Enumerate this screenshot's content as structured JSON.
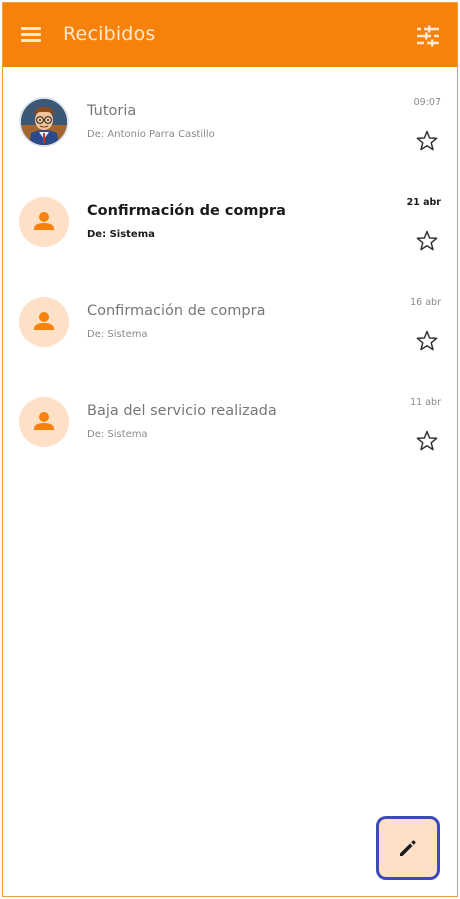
{
  "appbar": {
    "title": "Recibidos",
    "menu_icon": "menu-icon",
    "filter_icon": "tune-icon",
    "color": "#f6820c"
  },
  "messages": [
    {
      "subject": "Tutoria",
      "sender": "De: Antonio Parra Castillo",
      "date": "09:07",
      "unread": false,
      "avatar": "cartoon-teacher-avatar"
    },
    {
      "subject": "Confirmación de compra",
      "sender": "De: Sistema",
      "date": "21 abr",
      "unread": true,
      "avatar": "person-icon"
    },
    {
      "subject": "Confirmación de compra",
      "sender": "De: Sistema",
      "date": "16 abr",
      "unread": false,
      "avatar": "person-icon"
    },
    {
      "subject": "Baja del servicio realizada",
      "sender": "De: Sistema",
      "date": "11 abr",
      "unread": false,
      "avatar": "person-icon"
    }
  ],
  "fab": {
    "icon": "pencil-icon"
  }
}
